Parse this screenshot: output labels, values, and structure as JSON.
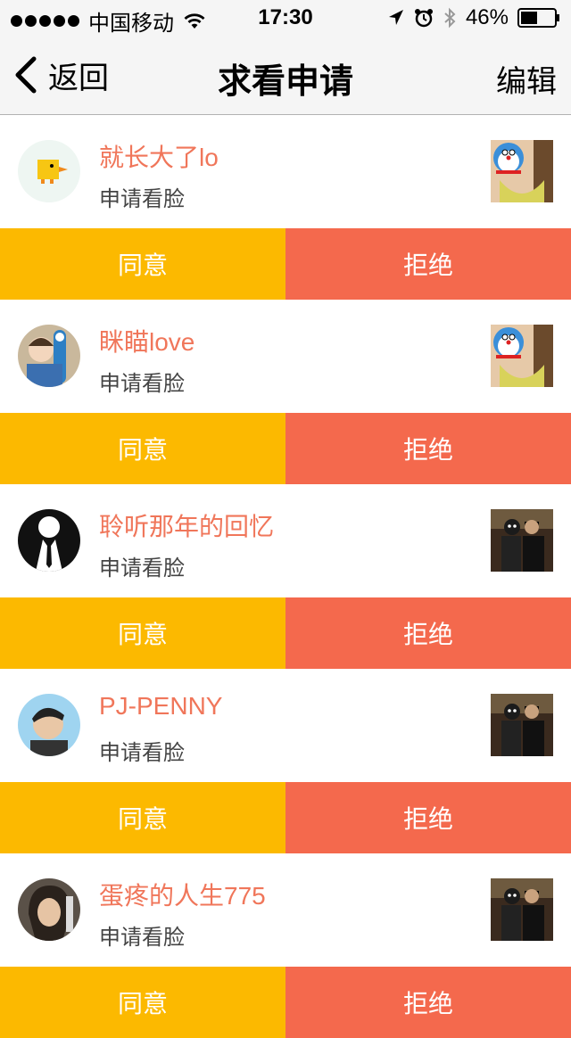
{
  "status_bar": {
    "carrier": "中国移动",
    "time": "17:30",
    "battery": "46%"
  },
  "nav": {
    "back_label": "返回",
    "title": "求看申请",
    "edit_label": "编辑"
  },
  "colors": {
    "agree": "#fcb900",
    "reject": "#f4694d",
    "name": "#f0765a"
  },
  "requests": [
    {
      "name": "就长大了lo",
      "subtitle": "申请看脸",
      "agree_label": "同意",
      "reject_label": "拒绝",
      "avatar_icon": "duck-avatar",
      "thumb_icon": "doraemon-photo"
    },
    {
      "name": "眯瞄love",
      "subtitle": "申请看脸",
      "agree_label": "同意",
      "reject_label": "拒绝",
      "avatar_icon": "child-avatar",
      "thumb_icon": "doraemon-photo"
    },
    {
      "name": "聆听那年的回忆",
      "subtitle": "申请看脸",
      "agree_label": "同意",
      "reject_label": "拒绝",
      "avatar_icon": "suit-avatar",
      "thumb_icon": "couple-photo"
    },
    {
      "name": "PJ-PENNY",
      "subtitle": "申请看脸",
      "agree_label": "同意",
      "reject_label": "拒绝",
      "avatar_icon": "man-avatar",
      "thumb_icon": "couple-photo"
    },
    {
      "name": "蛋疼的人生775",
      "subtitle": "申请看脸",
      "agree_label": "同意",
      "reject_label": "拒绝",
      "avatar_icon": "woman-avatar",
      "thumb_icon": "couple-photo"
    }
  ]
}
